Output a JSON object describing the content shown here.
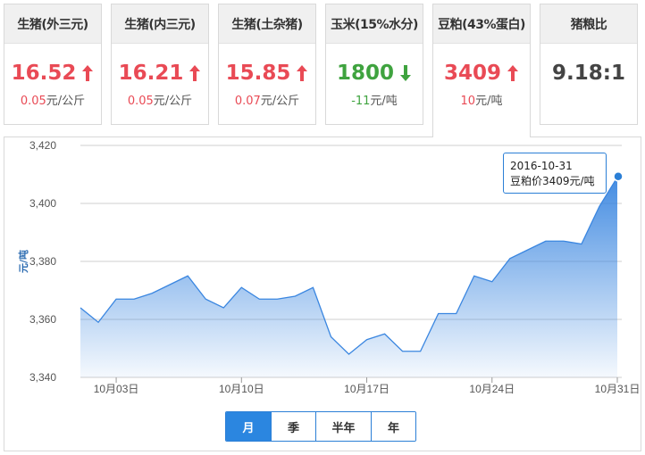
{
  "colors": {
    "up": "#e94a55",
    "down": "#3fa33f",
    "accent": "#2b86e0",
    "line": "#3a86e0"
  },
  "cards": [
    {
      "title": "生猪(外三元)",
      "price": "16.52",
      "direction": "up",
      "change": "0.05",
      "unit": "元/公斤"
    },
    {
      "title": "生猪(内三元)",
      "price": "16.21",
      "direction": "up",
      "change": "0.05",
      "unit": "元/公斤"
    },
    {
      "title": "生猪(土杂猪)",
      "price": "15.85",
      "direction": "up",
      "change": "0.07",
      "unit": "元/公斤"
    },
    {
      "title": "玉米(15%水分)",
      "price": "1800",
      "direction": "down",
      "change": "-11",
      "unit": "元/吨"
    },
    {
      "title": "豆粕(43%蛋白)",
      "price": "3409",
      "direction": "up",
      "change": "10",
      "unit": "元/吨"
    },
    {
      "title": "猪粮比",
      "price": "9.18:1",
      "direction": "none",
      "change": "",
      "unit": ""
    }
  ],
  "tooltip": {
    "date": "2016-10-31",
    "label": "豆粕价3409元/吨"
  },
  "tabs": [
    "月",
    "季",
    "半年",
    "年"
  ],
  "chart_data": {
    "type": "area",
    "ylabel": "元/吨",
    "ylim": [
      3340,
      3420
    ],
    "yticks": [
      3340,
      3360,
      3380,
      3400,
      3420
    ],
    "ytick_labels": [
      "3,340",
      "3,360",
      "3,380",
      "3,400",
      "3,420"
    ],
    "xtick_labels": [
      "10月03日",
      "10月10日",
      "10月17日",
      "10月24日",
      "10月31日"
    ],
    "xticks": [
      3,
      10,
      17,
      24,
      31
    ],
    "x": [
      1,
      2,
      3,
      4,
      5,
      6,
      7,
      8,
      9,
      10,
      11,
      12,
      13,
      14,
      15,
      16,
      17,
      18,
      19,
      20,
      21,
      22,
      23,
      24,
      25,
      26,
      27,
      28,
      29,
      30,
      31
    ],
    "series": [
      {
        "values": [
          3364,
          3359,
          3367,
          3367,
          3369,
          3372,
          3375,
          3367,
          3364,
          3371,
          3367,
          3367,
          3368,
          3371,
          3354,
          3348,
          3353,
          3355,
          3349,
          3349,
          3362,
          3362,
          3375,
          3373,
          3381,
          3384,
          3387,
          3387,
          3386,
          3399,
          3409
        ]
      }
    ],
    "grid": true
  }
}
